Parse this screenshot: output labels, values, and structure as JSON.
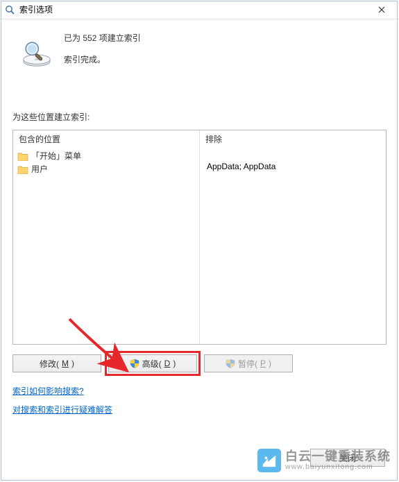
{
  "titlebar": {
    "title": "索引选项"
  },
  "status": {
    "items_indexed": "已为 552 项建立索引",
    "indexing_done": "索引完成。"
  },
  "locations_label": "为这些位置建立索引:",
  "list": {
    "include_header": "包含的位置",
    "exclude_header": "排除",
    "included": [
      {
        "label": "「开始」菜单"
      },
      {
        "label": "用户"
      }
    ],
    "excluded": [
      "",
      "AppData; AppData"
    ]
  },
  "buttons": {
    "modify_pre": "修改(",
    "modify_key": "M",
    "modify_post": ")",
    "advanced_pre": "高级(",
    "advanced_key": "D",
    "advanced_post": ")",
    "pause_pre": "暂停(",
    "pause_key": "P",
    "pause_post": ")",
    "close": "关闭"
  },
  "links": {
    "how_affects_search": "索引如何影响搜索?",
    "troubleshoot": "对搜索和索引进行疑难解答"
  },
  "watermark": {
    "title": "白云一键重装系统",
    "url": "www.baiyunxitong.com"
  }
}
